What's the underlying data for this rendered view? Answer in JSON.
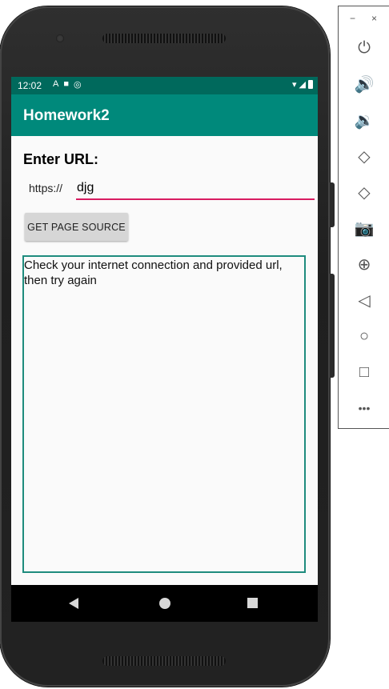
{
  "status_bar": {
    "time": "12:02",
    "icons_left": [
      "A",
      "■",
      "◎"
    ],
    "icons_right": [
      "▾",
      "◢"
    ]
  },
  "app_bar": {
    "title": "Homework2"
  },
  "form": {
    "heading": "Enter URL:",
    "url_prefix": "https://",
    "url_value": "djg",
    "button_label": "GET PAGE SOURCE"
  },
  "output": {
    "text": "Check your internet connection and provided url, then try again"
  },
  "colors": {
    "status_bar": "#00695c",
    "app_bar": "#00897b",
    "accent": "#d81b60",
    "output_border": "#1e8c7e"
  },
  "emulator_panel": {
    "minimize": "−",
    "close": "×",
    "items": [
      {
        "name": "power-icon",
        "glyph": "⏻"
      },
      {
        "name": "volume-up-icon",
        "glyph": "🔊"
      },
      {
        "name": "volume-down-icon",
        "glyph": "🔉"
      },
      {
        "name": "rotate-left-icon",
        "glyph": "◇"
      },
      {
        "name": "rotate-right-icon",
        "glyph": "◇"
      },
      {
        "name": "camera-icon",
        "glyph": "📷"
      },
      {
        "name": "zoom-icon",
        "glyph": "⊕"
      },
      {
        "name": "back-icon",
        "glyph": "◁"
      },
      {
        "name": "home-icon",
        "glyph": "○"
      },
      {
        "name": "overview-icon",
        "glyph": "□"
      },
      {
        "name": "more-icon",
        "glyph": "•••"
      }
    ]
  }
}
